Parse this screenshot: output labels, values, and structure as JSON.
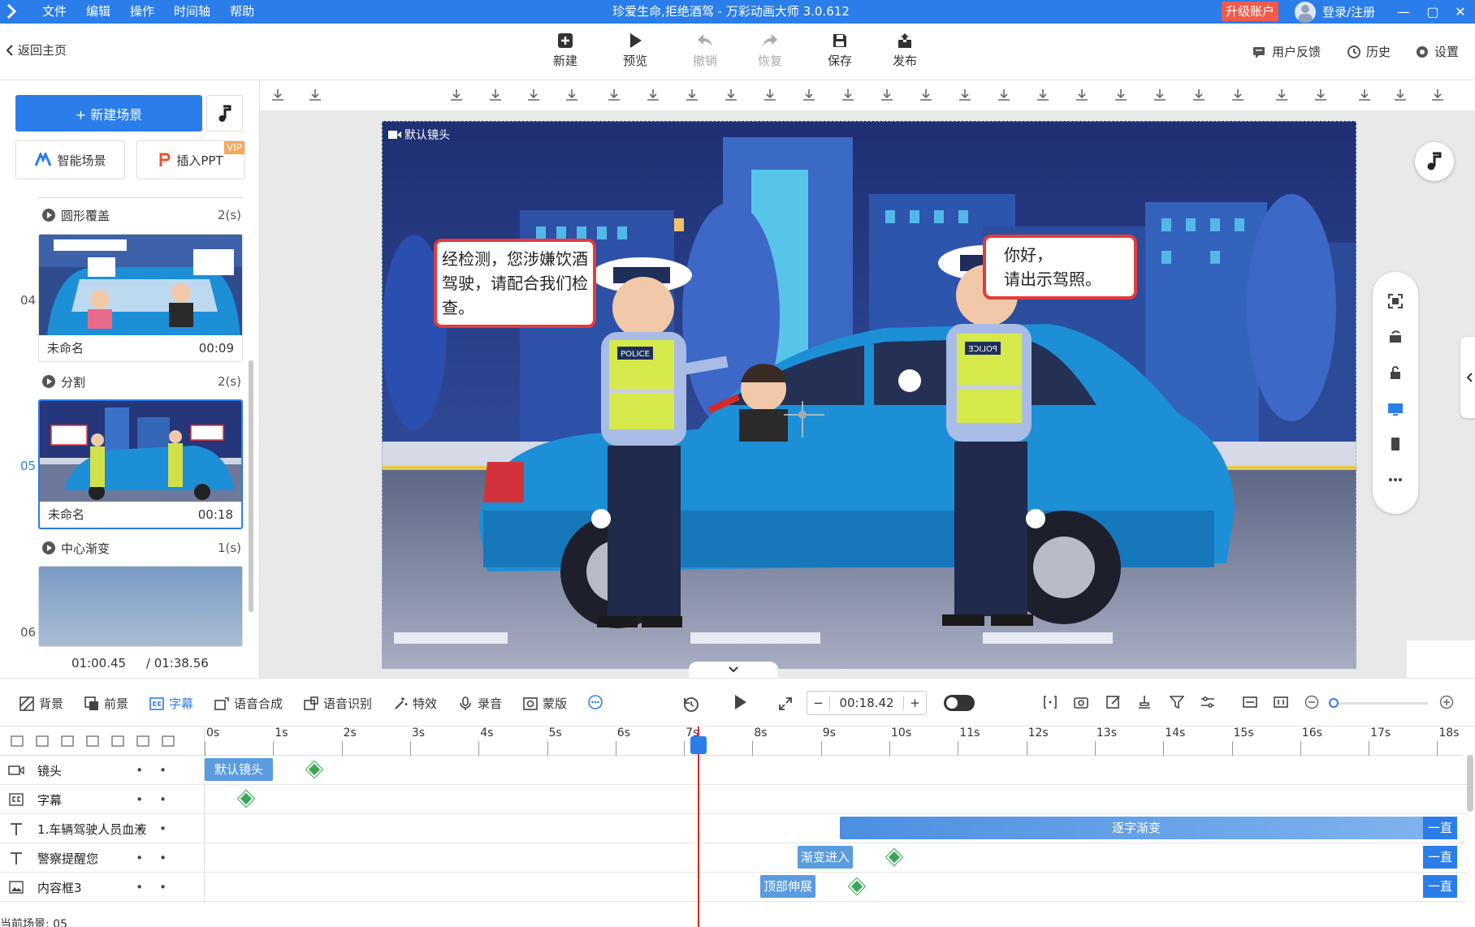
{
  "app": {
    "title": "珍爱生命,拒绝酒驾 - 万彩动画大师 3.0.612",
    "menu": [
      "文件",
      "编辑",
      "操作",
      "时间轴",
      "帮助"
    ],
    "upgrade_label": "升级账户",
    "login_label": "登录/注册"
  },
  "toolbar": {
    "back_label": "返回主页",
    "buttons": [
      {
        "label": "新建",
        "icon": "plus-square-icon",
        "enabled": true
      },
      {
        "label": "预览",
        "icon": "play-icon",
        "enabled": true
      },
      {
        "label": "撤销",
        "icon": "undo-icon",
        "enabled": false
      },
      {
        "label": "恢复",
        "icon": "redo-icon",
        "enabled": false
      },
      {
        "label": "保存",
        "icon": "save-icon",
        "enabled": true
      },
      {
        "label": "发布",
        "icon": "publish-icon",
        "enabled": true
      }
    ],
    "right_links": [
      {
        "label": "用户反馈",
        "icon": "feedback-icon"
      },
      {
        "label": "历史",
        "icon": "history-icon"
      },
      {
        "label": "设置",
        "icon": "gear-icon"
      }
    ]
  },
  "left_panel": {
    "new_scene_label": "+ 新建场景",
    "smart_scene_label": "智能场景",
    "insert_ppt_label": "插入PPT",
    "vip_badge": "VIP",
    "transitions": [
      {
        "name": "圆形覆盖",
        "duration": "2(s)"
      },
      {
        "name": "分割",
        "duration": "2(s)"
      },
      {
        "name": "中心渐变",
        "duration": "1(s)"
      }
    ],
    "scenes": [
      {
        "number": "04",
        "name": "未命名",
        "duration": "00:09",
        "selected": false
      },
      {
        "number": "05",
        "name": "未命名",
        "duration": "00:18",
        "selected": true
      },
      {
        "number": "06",
        "name": "",
        "duration": "",
        "selected": false
      }
    ],
    "current_time": "01:00.45",
    "total_time": "/ 01:38.56"
  },
  "canvas": {
    "camera_label": "默认镜头",
    "bubble_left": "经检测，您涉嫌饮酒驾驶，请配合我们检查。",
    "bubble_right_line1": "你好，",
    "bubble_right_line2": "请出示驾照。",
    "badge_left": "POLICE",
    "badge_right": "POLICE"
  },
  "bottom_toolbar": {
    "items": [
      {
        "label": "背景",
        "icon": "background-icon",
        "active": false
      },
      {
        "label": "前景",
        "icon": "foreground-icon",
        "active": false
      },
      {
        "label": "字幕",
        "icon": "caption-icon",
        "active": true
      },
      {
        "label": "语音合成",
        "icon": "tts-icon",
        "active": false
      },
      {
        "label": "语音识别",
        "icon": "speech-recognition-icon",
        "active": false
      },
      {
        "label": "特效",
        "icon": "effects-icon",
        "active": false
      },
      {
        "label": "录音",
        "icon": "microphone-icon",
        "active": false
      },
      {
        "label": "蒙版",
        "icon": "mask-icon",
        "active": false
      }
    ],
    "current_time": "00:18.42"
  },
  "timeline": {
    "ruler_ticks": [
      "0s",
      "1s",
      "2s",
      "3s",
      "4s",
      "5s",
      "6s",
      "7s",
      "8s",
      "9s",
      "10s",
      "11s",
      "12s",
      "13s",
      "14s",
      "15s",
      "16s",
      "17s",
      "18s"
    ],
    "playhead_seconds": 7.2,
    "tracks": [
      {
        "label": "镜头",
        "icon": "camera-icon",
        "clip": "默认镜头"
      },
      {
        "label": "字幕",
        "icon": "caption-icon",
        "clip": ""
      },
      {
        "label": "1.车辆驾驶人员血液",
        "icon": "text-icon",
        "clip": "逐字渐变",
        "end": "一直"
      },
      {
        "label": "警察提醒您",
        "icon": "text-icon",
        "clip": "渐变进入",
        "end": "一直"
      },
      {
        "label": "内容框3",
        "icon": "image-icon",
        "clip": "顶部伸展",
        "end": "一直"
      }
    ],
    "current_scene_label": "当前场景: 05"
  },
  "colors": {
    "accent": "#2b7de9",
    "upgrade": "#f25b4b",
    "keyframe": "#3aa757",
    "playhead": "#d9272e"
  }
}
